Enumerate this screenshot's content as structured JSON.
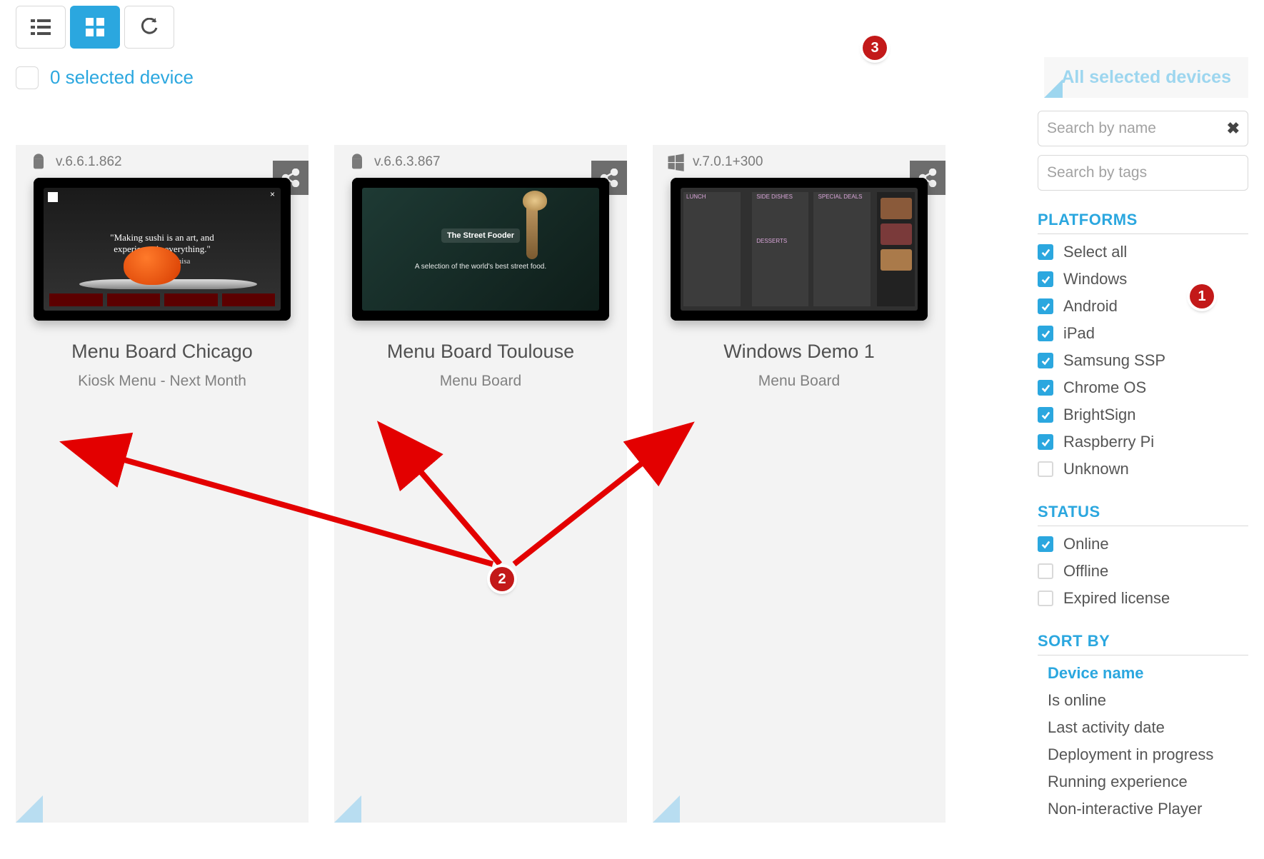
{
  "toolbar": {
    "view_list_active": false,
    "view_grid_active": true
  },
  "selection": {
    "counter_label": "0 selected device",
    "all_label": "All selected devices"
  },
  "devices": [
    {
      "platform": "android",
      "version": "v.6.6.1.862",
      "title": "Menu Board Chicago",
      "subtitle": "Kiosk Menu - Next Month",
      "thumb_caption_1": "\"Making sushi is an art, and",
      "thumb_caption_2": "experience is everything.\"",
      "thumb_caption_3": "- Nobu Matsuhisa"
    },
    {
      "platform": "android",
      "version": "v.6.6.3.867",
      "title": "Menu Board Toulouse",
      "subtitle": "Menu Board",
      "thumb_brand": "The Street Fooder",
      "thumb_tag": "A selection of the world's best street food."
    },
    {
      "platform": "windows",
      "version": "v.7.0.1+300",
      "title": "Windows Demo 1",
      "subtitle": "Menu Board",
      "thumb_cols": [
        "LUNCH",
        "SIDE DISHES",
        "SPECIAL DEALS",
        "DESSERTS"
      ]
    }
  ],
  "sidebar": {
    "search_name_placeholder": "Search by name",
    "search_tags_placeholder": "Search by tags",
    "platforms_title": "PLATFORMS",
    "platforms": [
      {
        "label": "Select all",
        "checked": true
      },
      {
        "label": "Windows",
        "checked": true
      },
      {
        "label": "Android",
        "checked": true
      },
      {
        "label": "iPad",
        "checked": true
      },
      {
        "label": "Samsung SSP",
        "checked": true
      },
      {
        "label": "Chrome OS",
        "checked": true
      },
      {
        "label": "BrightSign",
        "checked": true
      },
      {
        "label": "Raspberry Pi",
        "checked": true
      },
      {
        "label": "Unknown",
        "checked": false
      }
    ],
    "status_title": "STATUS",
    "status": [
      {
        "label": "Online",
        "checked": true
      },
      {
        "label": "Offline",
        "checked": false
      },
      {
        "label": "Expired license",
        "checked": false
      }
    ],
    "sort_title": "SORT BY",
    "sort": [
      {
        "label": "Device name",
        "active": true
      },
      {
        "label": "Is online",
        "active": false
      },
      {
        "label": "Last activity date",
        "active": false
      },
      {
        "label": "Deployment in progress",
        "active": false
      },
      {
        "label": "Running experience",
        "active": false
      },
      {
        "label": "Non-interactive Player",
        "active": false
      }
    ]
  },
  "annotations": {
    "b1": "1",
    "b2": "2",
    "b3": "3"
  }
}
